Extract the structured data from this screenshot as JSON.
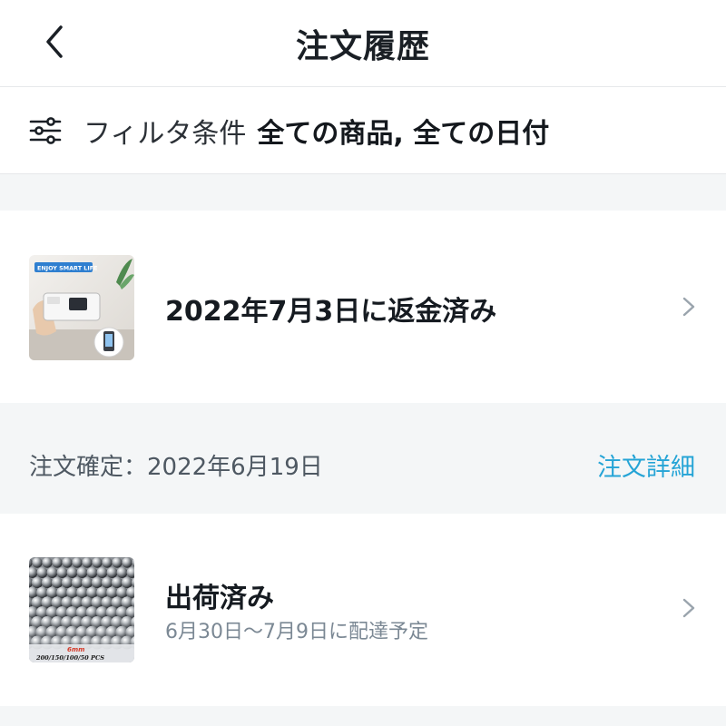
{
  "header": {
    "title": "注文履歴",
    "back_icon": "chevron-left-icon"
  },
  "filter": {
    "icon": "sliders-icon",
    "label": "フィルタ条件",
    "value": "全ての商品, 全ての日付"
  },
  "orders": [
    {
      "status": "2022年7月3日に返金済み",
      "thumbnail": {
        "caption": "ENJOY SMART LIFE"
      }
    },
    {
      "confirmed": "注文確定：2022年6月19日",
      "detail_link": "注文詳細",
      "status": "出荷済み",
      "delivery": "6月30日～7月9日に配達予定",
      "thumbnail": {
        "size_label": "6mm",
        "count_label": "200/150/100/50 PCS"
      }
    }
  ],
  "colors": {
    "accent": "#25a4d6",
    "background": "#f4f6f7",
    "card": "#ffffff",
    "muted": "#7b8894"
  }
}
